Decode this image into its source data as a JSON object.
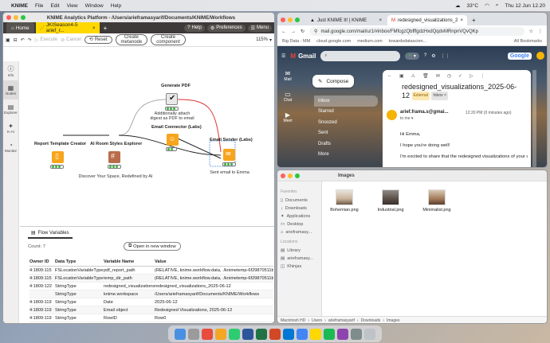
{
  "menubar": {
    "app": "KNIME",
    "items": [
      "File",
      "Edit",
      "View",
      "Window",
      "Help"
    ],
    "temp": "33°C",
    "clock": "Thu 12 Jun 12.20"
  },
  "knime": {
    "title": "KNIME Analytics Platform - /Users/arieframasyarif/Documents/KNIME/Workflows",
    "home_tab": "Home",
    "workflow_tab": "JKISeason4-5 arief_r...",
    "help": "Help",
    "preferences": "Preferences",
    "menu": "Menu",
    "toolbar": {
      "execute": "Execute",
      "cancel": "Cancel",
      "reset": "Reset",
      "create_metanode": [
        "Create",
        "metanode"
      ],
      "create_component": [
        "Create",
        "component"
      ],
      "zoom": "115%"
    },
    "sidebar": [
      "Info",
      "Nodes",
      "Explorer",
      "K-AI",
      "Monitor"
    ],
    "nodes": {
      "report": "Report Template Creator",
      "styles": "AI Room Styles Explorer",
      "pdf": "Generate PDF",
      "connector": "Email Connector (Labs)",
      "sender": "Email Sender (Labs)"
    },
    "descriptions": {
      "styles": "Discover Your Space, Redefined by AI",
      "pdf": [
        "Additionally attach",
        "digest as PDF to email"
      ],
      "sender": "Sent email to Emma"
    },
    "panel": {
      "tab": "Flow Variables",
      "count": "Count: 7",
      "open_window": "Open in new window",
      "columns": [
        "Owner ID",
        "Data Type",
        "Variable Name",
        "Value"
      ],
      "rows": [
        [
          "4:1809:115",
          "FSLocationVariableType",
          "pdf_report_path",
          "(RELATIVE, knime.workflow.data, ./knimetemp-6f29870511b0"
        ],
        [
          "4:1809:115",
          "FSLocationVariableType",
          "temp_dir_path",
          "(RELATIVE, knime.workflow.data, ./knimetemp-6f29870511b0"
        ],
        [
          "4:1809:122",
          "StringType",
          "redesigned_visualizations",
          "redesigned_visualizations_2025-06-12"
        ],
        [
          "",
          "StringType",
          "knime.workspace",
          "/Users/arieframasyarif/Documents/KNIME/Workflows"
        ],
        [
          "4:1809:119",
          "StringType",
          "Date",
          "2025-06-12"
        ],
        [
          "4:1809:119",
          "StringType",
          "Email object",
          "Redesigned Visualizations, 2025-06-12"
        ],
        [
          "4:1809:119",
          "StringType",
          "RowID",
          "Row0"
        ]
      ]
    }
  },
  "chrome": {
    "tabs": [
      "Just KNIME It! | KNIME",
      "redesigned_visualizations_2"
    ],
    "url": "mail.google.com/mail/u/1/#inbox/FMfcgzQbfffgdzHxdQqdvMRnpnVQvQKp",
    "bookmarks": [
      "Big Data - MM",
      "cloud.google.com",
      "medium.com",
      "towardsdatascien...",
      "All Bookmarks"
    ]
  },
  "gmail": {
    "logo": "Gmail",
    "rail": [
      "Mail",
      "Chat",
      "Meet"
    ],
    "compose": "Compose",
    "nav": [
      "Inbox",
      "Starred",
      "Snoozed",
      "Sent",
      "Drafts",
      "More"
    ],
    "subject": "redesigned_visualizations_2025-06-12",
    "label_external": "External",
    "label_inbox": "Inbox ×",
    "from": "arief.frama.s@gmai...",
    "time": "12:20 PM (0 minutes ago)",
    "to": "to me",
    "body": [
      "Hi Emma,",
      "I hope you're doing well!",
      "I'm excited to share that the redesigned visualizations of your s"
    ]
  },
  "finder": {
    "title": "Images",
    "favorites_label": "Favorites",
    "favorites": [
      "Documents",
      "Downloads",
      "Applications",
      "Desktop",
      "arieframasy..."
    ],
    "locations_label": "Locations",
    "locations": [
      "Library",
      "arieframasy...",
      "Khinjas"
    ],
    "files": [
      "Bohemian.png",
      "Industrial.png",
      "Minimalist.png"
    ],
    "path": [
      "Macintosh HD",
      "Users",
      "arieframasyarif",
      "Downloads",
      "Images"
    ]
  },
  "colors": {
    "knime_yellow": "#ffd800",
    "node_orange": "#f7a51c",
    "node_brown": "#b96c4a",
    "gmail_blue": "#1a73e8"
  }
}
